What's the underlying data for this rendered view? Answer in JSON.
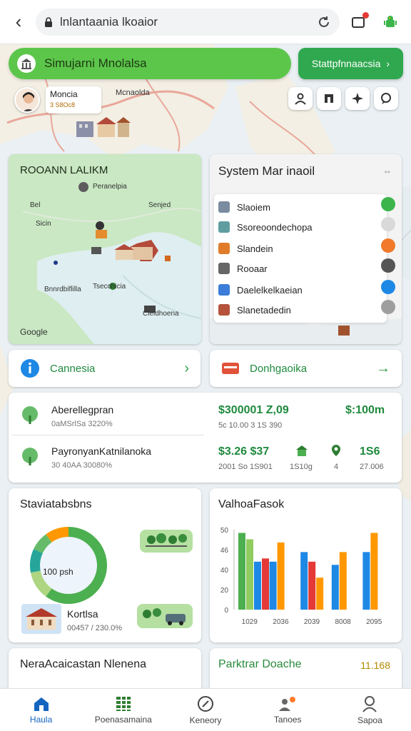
{
  "browser": {
    "url": "lnlantaania lkoaior"
  },
  "header": {
    "app_title": "Simujarni Mnolalsa",
    "start_button": "Stattpfnnaacsia"
  },
  "profile": {
    "name": "Moncia",
    "sub": "3 S8Oc8"
  },
  "map_labels": {
    "top": "Mcnaolda"
  },
  "region_map": {
    "title": "ROOANN LALIKM",
    "labels": [
      "Peranelpia",
      "Bel",
      "Senjed",
      "Sicin",
      "Bnnrdbiflilla",
      "Tsecchicia",
      "Cleldhoena"
    ],
    "attribution": "Google"
  },
  "system": {
    "title": "System Mar inaoil",
    "items": [
      {
        "label": "Slaoiem",
        "status_color": "#3cb54a"
      },
      {
        "label": "Ssoreoondechopa",
        "status_color": "#d9d9d9"
      },
      {
        "label": "Slandein",
        "status_color": "#f07a2a"
      },
      {
        "label": "Rooaar",
        "status_color": "#555555"
      },
      {
        "label": "Daelelkelkaeian",
        "status_color": "#1e88e5"
      },
      {
        "label": "Slanetadedin",
        "status_color": "#9e9e9e"
      }
    ]
  },
  "nav_buttons": [
    {
      "label": "Cannesia"
    },
    {
      "label": "Donhgaoika"
    }
  ],
  "stats": {
    "rows": [
      {
        "name": "Aberellegpran",
        "sub": "0aMSrlSa 3220%",
        "big1": "$300001 Z,09",
        "small1": "5c 10.00 3 1S 390",
        "big2": "$:100m"
      },
      {
        "name": "PayronyanKatnilanoka",
        "sub": "30 40AA 30080%",
        "big1": "$3.26 $37",
        "small1": "2001 So 1S901",
        "stat_a": "1S10g",
        "stat_b": "4",
        "big2": "1S6",
        "small2": "27.006"
      }
    ]
  },
  "status_card": {
    "title": "Staviatabsbns",
    "donut_label": "100 psh",
    "place_name": "Kortlsa",
    "place_sub": "00457 / 230.0%",
    "donut_segments": [
      {
        "value": 60,
        "color": "#4caf50"
      },
      {
        "value": 12,
        "color": "#aed581"
      },
      {
        "value": 10,
        "color": "#26a69a"
      },
      {
        "value": 8,
        "color": "#66bb6a"
      },
      {
        "value": 10,
        "color": "#ff9800"
      }
    ]
  },
  "chart_data": {
    "type": "bar",
    "title": "ValhoaFasok",
    "categories": [
      "1029",
      "2036",
      "2039",
      "8008",
      "2095"
    ],
    "ylim": [
      0,
      50
    ],
    "yticks": [
      "50",
      "46",
      "40",
      "20",
      "0"
    ],
    "series": [
      {
        "color": "#4caf50",
        "values": [
          48,
          0,
          0,
          0,
          0
        ]
      },
      {
        "color": "#90cc5f",
        "values": [
          44,
          0,
          0,
          0,
          0
        ]
      },
      {
        "color": "#1e88e5",
        "values": [
          30,
          30,
          36,
          28,
          36
        ]
      },
      {
        "color": "#e53935",
        "values": [
          32,
          0,
          30,
          0,
          0
        ]
      },
      {
        "color": "#ff9800",
        "values": [
          0,
          42,
          20,
          36,
          48
        ]
      }
    ]
  },
  "partial_cards": {
    "left_title": "NeraAcaicastan Nlenena",
    "right_title": "Parktrar Doache",
    "right_value": "11.168"
  },
  "bottom_nav": [
    {
      "label": "Haula",
      "icon": "home-icon"
    },
    {
      "label": "Poenasamaina",
      "icon": "grid-icon"
    },
    {
      "label": "Keneory",
      "icon": "compass-icon"
    },
    {
      "label": "Tanoes",
      "icon": "people-icon"
    },
    {
      "label": "Sapoa",
      "icon": "user-icon"
    }
  ]
}
